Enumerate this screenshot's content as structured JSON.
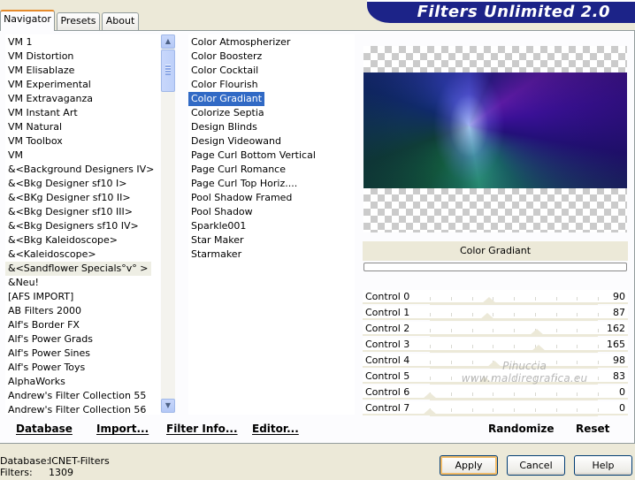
{
  "tabs": [
    "Navigator",
    "Presets",
    "About"
  ],
  "banner": {
    "title": "Filters Unlimited 2.0"
  },
  "categories": [
    "VM 1",
    "VM Distortion",
    "VM Elisablaze",
    "VM Experimental",
    "VM Extravaganza",
    "VM Instant Art",
    "VM Natural",
    "VM Toolbox",
    "VM",
    "&<Background Designers IV>",
    "&<Bkg Designer sf10 I>",
    "&<BKg Designer sf10 II>",
    "&<Bkg Designer sf10 III>",
    "&<Bkg Designers sf10 IV>",
    "&<Bkg Kaleidoscope>",
    "&<Kaleidoscope>",
    "&<Sandflower Specials°v° >",
    "&Neu!",
    "[AFS IMPORT]",
    "AB Filters 2000",
    "Alf's Border FX",
    "Alf's Power Grads",
    "Alf's Power Sines",
    "Alf's Power Toys",
    "AlphaWorks",
    "Andrew's Filter Collection 55",
    "Andrew's Filter Collection 56"
  ],
  "categories_highlighted_index": 16,
  "filters": [
    "Color Atmospherizer",
    "Color Boosterz",
    "Color Cocktail",
    "Color Flourish",
    "Color Gradiant",
    "Colorize Septia",
    "Design Blinds",
    "Design Videowand",
    "Page Curl Bottom Vertical",
    "Page Curl Romance",
    "Page Curl Top Horiz....",
    "Pool Shadow Framed",
    "Pool Shadow",
    "Sparkle001",
    "Star Maker",
    "Starmaker"
  ],
  "filters_selected_index": 4,
  "selected_filter_name": "Color Gradiant",
  "controls": [
    {
      "label": "Control 0",
      "value": 90
    },
    {
      "label": "Control 1",
      "value": 87
    },
    {
      "label": "Control 2",
      "value": 162
    },
    {
      "label": "Control 3",
      "value": 165
    },
    {
      "label": "Control 4",
      "value": 98
    },
    {
      "label": "Control 5",
      "value": 83
    },
    {
      "label": "Control 6",
      "value": 0
    },
    {
      "label": "Control 7",
      "value": 0
    }
  ],
  "control_max": 255,
  "links": {
    "database": "Database",
    "import": "Import...",
    "filter_info": "Filter Info...",
    "editor": "Editor..."
  },
  "randomize": "Randomize",
  "reset": "Reset",
  "watermark": {
    "line1": "Pinuccia",
    "line2": "www.maldiregrafica.eu"
  },
  "footer": {
    "database_label": "Database:",
    "database_value": "ICNET-Filters",
    "filters_label": "Filters:",
    "filters_value": "1309"
  },
  "buttons": {
    "apply": "Apply",
    "cancel": "Cancel",
    "help": "Help"
  },
  "colors": {
    "banner": "#1c2388",
    "selection": "#316ac5",
    "dialog_bg": "#ece9d8"
  },
  "icons": {
    "scroll_up": "chevron-up-icon",
    "scroll_down": "chevron-down-icon"
  }
}
